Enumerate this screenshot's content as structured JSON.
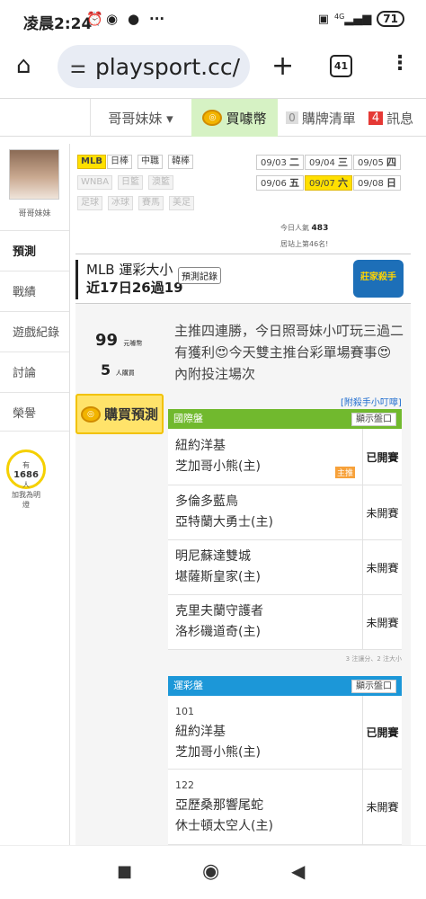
{
  "status": {
    "time": "凌晨2:24",
    "icons": [
      "alarm-icon",
      "vpn-icon",
      "chat-icon",
      "more-icon"
    ],
    "network": "4G",
    "battery": "71"
  },
  "browser": {
    "url": "playsport.cc/",
    "tab_count": "41"
  },
  "sitenav": {
    "user_menu": "哥哥妹妹 ▾",
    "buy_coin": "買噱幣",
    "cart_count": "0",
    "cart": "購牌清單",
    "msg_count": "4",
    "messages": "訊息"
  },
  "sidebar": {
    "name": "哥哥妹妹",
    "tabs": [
      "預測",
      "戰績",
      "遊戲紀錄",
      "討論",
      "榮譽"
    ],
    "fans_count": "1686",
    "fans_prefix": "有",
    "fans_suffix": "人",
    "fans_label": "加我為明燈"
  },
  "sports": {
    "row1": [
      "MLB",
      "日棒",
      "中職",
      "韓棒"
    ],
    "row2": [
      "WNBA",
      "日籃",
      "澳籃"
    ],
    "row3": [
      "足球",
      "冰球",
      "賽馬",
      "美足"
    ]
  },
  "dates": [
    {
      "md": "09/03",
      "wd": "二"
    },
    {
      "md": "09/04",
      "wd": "三"
    },
    {
      "md": "09/05",
      "wd": "四"
    },
    {
      "md": "09/06",
      "wd": "五"
    },
    {
      "md": "09/07",
      "wd": "六"
    },
    {
      "md": "09/08",
      "wd": "日"
    }
  ],
  "popularity": {
    "label": "今日人氣",
    "value": "483",
    "rank_text": "居站上第46名!"
  },
  "title": {
    "line1": "MLB 運彩大小",
    "line2": "近17日26過19",
    "record_button": "預測記錄",
    "badge": "莊家殺手"
  },
  "stats": {
    "price": "99",
    "price_unit": "元噱幣",
    "buyers": "5",
    "buyers_unit": "人購買"
  },
  "description": "主推四連勝，今日照哥妹小叮玩三過二有獲利😍今天雙主推台彩單場賽事😍內附投注場次",
  "buy_button": "購買預測",
  "killer_link": "[附殺手小叮嚀]",
  "intl": {
    "title": "國際盤",
    "show_button": "顯示盤口",
    "games": [
      {
        "away": "紐約洋基",
        "home": "芝加哥小熊(主)",
        "status": "已開賽",
        "tag": "主推"
      },
      {
        "away": "多倫多藍鳥",
        "home": "亞特蘭大勇士(主)",
        "status": "未開賽"
      },
      {
        "away": "明尼蘇達雙城",
        "home": "堪薩斯皇家(主)",
        "status": "未開賽"
      },
      {
        "away": "克里夫蘭守護者",
        "home": "洛杉磯道奇(主)",
        "status": "未開賽"
      }
    ],
    "note": "3 注讓分、2 注大小"
  },
  "taiwan": {
    "title": "運彩盤",
    "show_button": "顯示盤口",
    "games": [
      {
        "num": "101",
        "away": "紐約洋基",
        "home": "芝加哥小熊(主)",
        "status": "已開賽"
      },
      {
        "num": "122",
        "away": "亞歷桑那響尾蛇",
        "home": "休士頓太空人(主)",
        "status": "未開賽"
      }
    ]
  },
  "navbar": [
    "recents-button",
    "home-button",
    "back-button"
  ]
}
